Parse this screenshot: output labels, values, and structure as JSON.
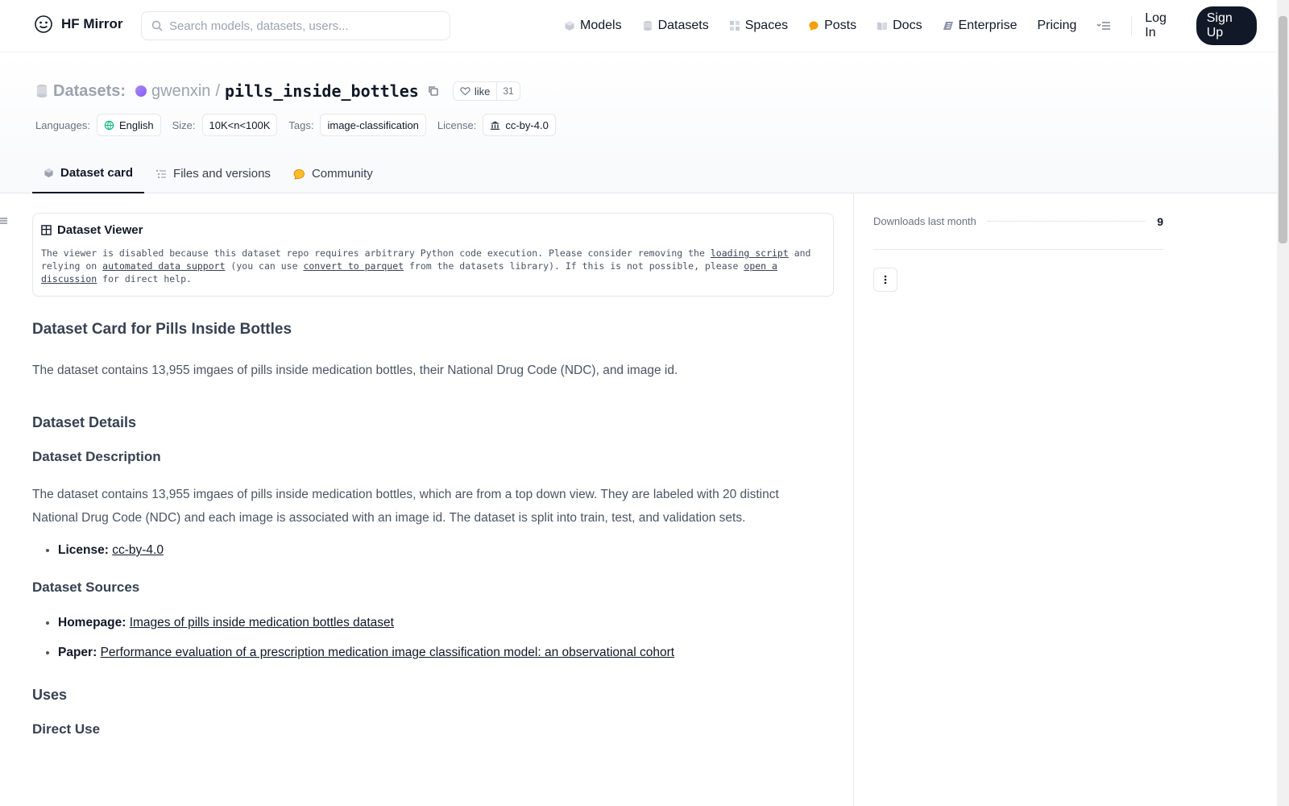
{
  "header": {
    "brand": "HF Mirror",
    "search_placeholder": "Search models, datasets, users...",
    "nav": [
      {
        "label": "Models",
        "icon": "cube-icon"
      },
      {
        "label": "Datasets",
        "icon": "database-icon"
      },
      {
        "label": "Spaces",
        "icon": "grid-icon"
      },
      {
        "label": "Posts",
        "icon": "message-icon"
      },
      {
        "label": "Docs",
        "icon": "book-icon"
      },
      {
        "label": "Enterprise",
        "icon": "enterprise-icon"
      },
      {
        "label": "Pricing"
      }
    ],
    "login": "Log In",
    "signup": "Sign Up"
  },
  "repo": {
    "section": "Datasets:",
    "owner": "gwenxin",
    "separator": "/",
    "name": "pills_inside_bottles",
    "like_label": "like",
    "like_count": "31",
    "meta": {
      "languages_label": "Languages:",
      "language": "English",
      "size_label": "Size:",
      "size": "10K<n<100K",
      "tags_label": "Tags:",
      "tag": "image-classification",
      "license_label": "License:",
      "license": "cc-by-4.0"
    },
    "tabs": [
      "Dataset card",
      "Files and versions",
      "Community"
    ]
  },
  "viewer": {
    "title": "Dataset Viewer",
    "text_1": "The viewer is disabled because this dataset repo requires arbitrary Python code execution. Please consider removing the ",
    "link_1": "loading script",
    "text_2": " and relying on ",
    "link_2": "automated data support",
    "text_3": " (you can use ",
    "link_3": "convert to parquet",
    "text_4": " from the datasets library). If this is not possible, please ",
    "link_4": "open a discussion",
    "text_5": " for direct help."
  },
  "card": {
    "title": "Dataset Card for Pills Inside Bottles",
    "intro": "The dataset contains 13,955 imgaes of pills inside medication bottles, their National Drug Code (NDC), and image id.",
    "details_heading": "Dataset Details",
    "description_heading": "Dataset Description",
    "description": "The dataset contains 13,955 imgaes of pills inside medication bottles, which are from a top down view. They are labeled with 20 distinct National Drug Code (NDC) and each image is associated with an image id. The dataset is split into train, test, and validation sets.",
    "license_label": "License:",
    "license_value": "cc-by-4.0",
    "sources_heading": "Dataset Sources",
    "homepage_label": "Homepage:",
    "homepage_value": "Images of pills inside medication bottles dataset",
    "paper_label": "Paper:",
    "paper_value": "Performance evaluation of a prescription medication image classification model: an observational cohort",
    "uses_heading": "Uses",
    "direct_use_heading": "Direct Use"
  },
  "sidebar": {
    "downloads_label": "Downloads last month",
    "downloads_value": "9"
  }
}
